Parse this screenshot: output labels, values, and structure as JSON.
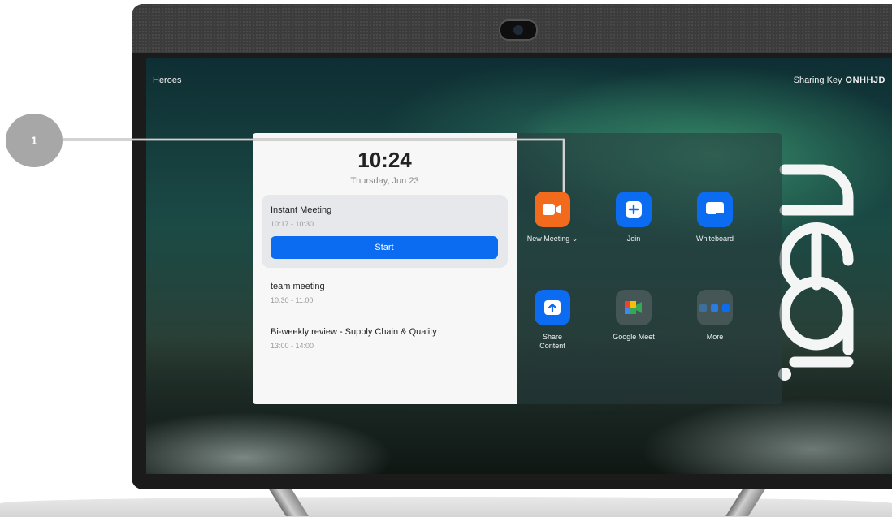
{
  "screen": {
    "room_name": "Heroes",
    "sharing_key_label": "Sharing Key",
    "sharing_key_value": "ONHHJD"
  },
  "calendar": {
    "time": "10:24",
    "date": "Thursday, Jun 23",
    "current_meeting": {
      "title": "Instant Meeting",
      "time": "10:17 - 10:30",
      "button_label": "Start"
    },
    "meetings": [
      {
        "title": "team meeting",
        "time": "10:30 - 11:00"
      },
      {
        "title": "Bi-weekly review - Supply Chain & Quality",
        "time": "13:00 - 14:00"
      }
    ]
  },
  "apps": [
    {
      "label": "New Meeting",
      "icon": "video-camera-icon",
      "color": "#f26b1d"
    },
    {
      "label": "Join",
      "icon": "plus-icon",
      "color": "#0b6cf2"
    },
    {
      "label": "Whiteboard",
      "icon": "whiteboard-icon",
      "color": "#0b6cf2"
    },
    {
      "label": "Share",
      "label2": "Content",
      "icon": "share-up-arrow-icon",
      "color": "#0b6cf2"
    },
    {
      "label": "Google Meet",
      "icon": "google-meet-icon",
      "color": "#4a5a5a"
    },
    {
      "label": "More",
      "icon": "more-apps-icon",
      "color": "#4a5a5a"
    }
  ],
  "callout": {
    "number": "1"
  },
  "brand": {
    "logo": "neat."
  }
}
